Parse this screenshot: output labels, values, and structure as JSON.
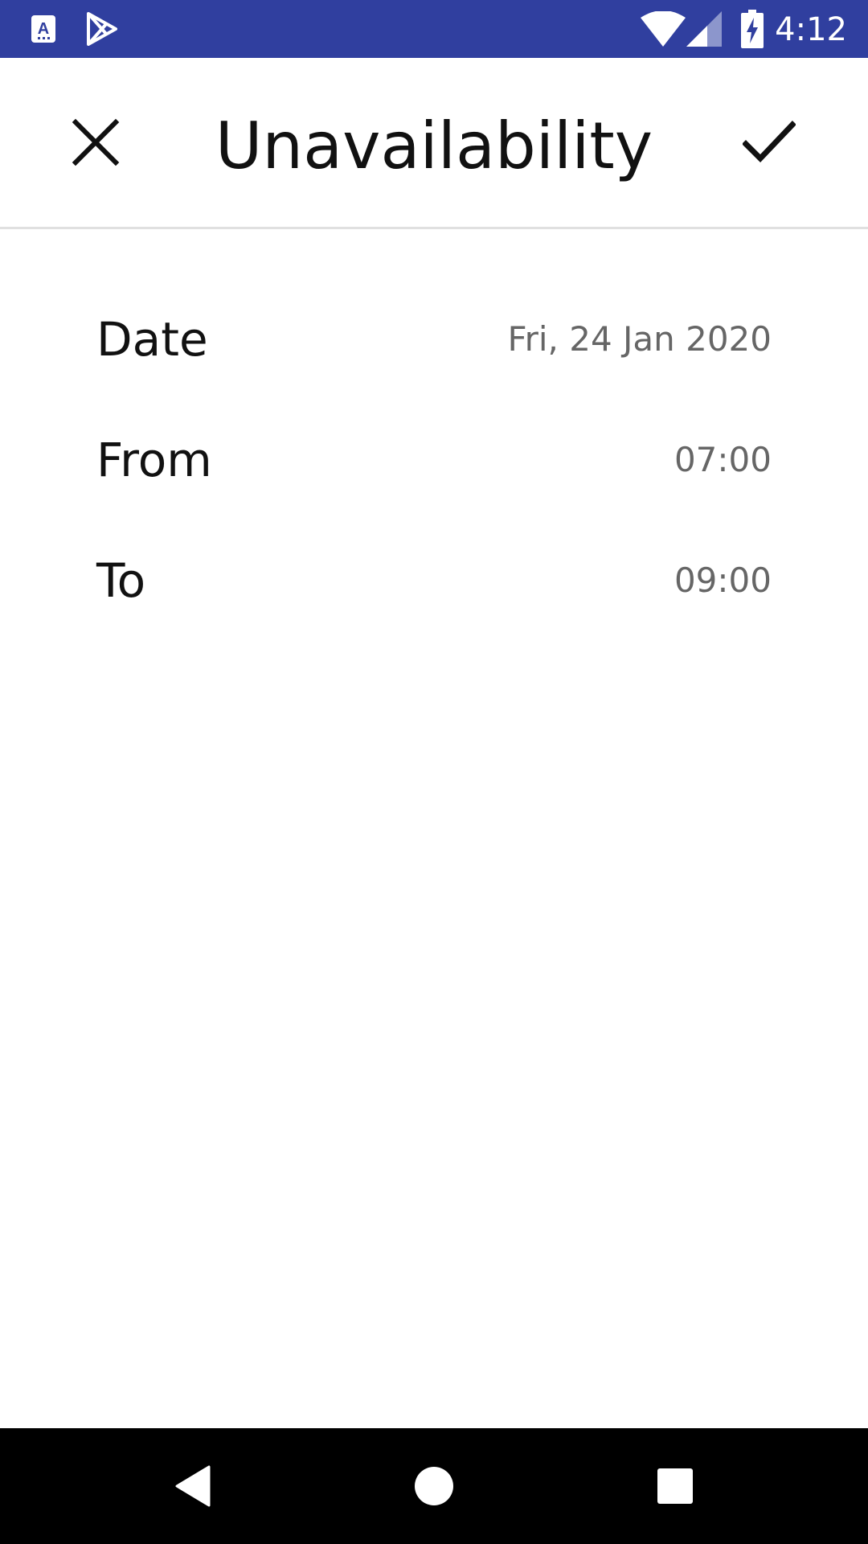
{
  "status_bar": {
    "time": "4:12",
    "background_color": "#303F9F",
    "icons": [
      "app-store-notification-icon",
      "play-store-notification-icon",
      "wifi-icon",
      "cell-signal-icon",
      "battery-charging-icon"
    ]
  },
  "app_bar": {
    "title": "Unavailability",
    "close_icon": "close-icon",
    "confirm_icon": "check-icon"
  },
  "form": {
    "rows": [
      {
        "label": "Date",
        "value": "Fri, 24 Jan 2020"
      },
      {
        "label": "From",
        "value": "07:00"
      },
      {
        "label": "To",
        "value": "09:00"
      }
    ]
  },
  "nav_bar": {
    "icons": [
      "back-icon",
      "home-icon",
      "recents-icon"
    ]
  },
  "colors": {
    "primary_dark": "#303F9F",
    "text_primary": "#111111",
    "text_secondary": "#666666",
    "divider": "#e0e0e0"
  }
}
